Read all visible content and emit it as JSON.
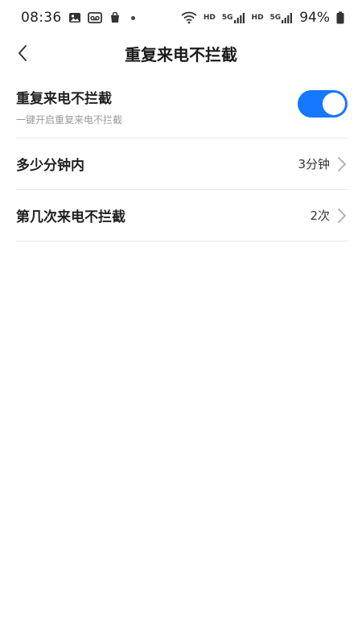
{
  "status_bar": {
    "time": "08:36",
    "hd_label_1": "HD",
    "signal_label_1": "5G",
    "hd_label_2": "HD",
    "signal_label_2": "5G",
    "battery": "94%"
  },
  "header": {
    "title": "重复来电不拦截"
  },
  "settings": {
    "toggle_row": {
      "title": "重复来电不拦截",
      "subtitle": "一键开启重复来电不拦截",
      "enabled_fraction": 1
    },
    "minutes_row": {
      "title": "多少分钟内",
      "value": "3分钟"
    },
    "count_row": {
      "title": "第几次来电不拦截",
      "value": "2次"
    }
  },
  "colors": {
    "accent": "#1677ff",
    "divider": "#e8e8e8",
    "subtitle": "#9a9a9a"
  }
}
